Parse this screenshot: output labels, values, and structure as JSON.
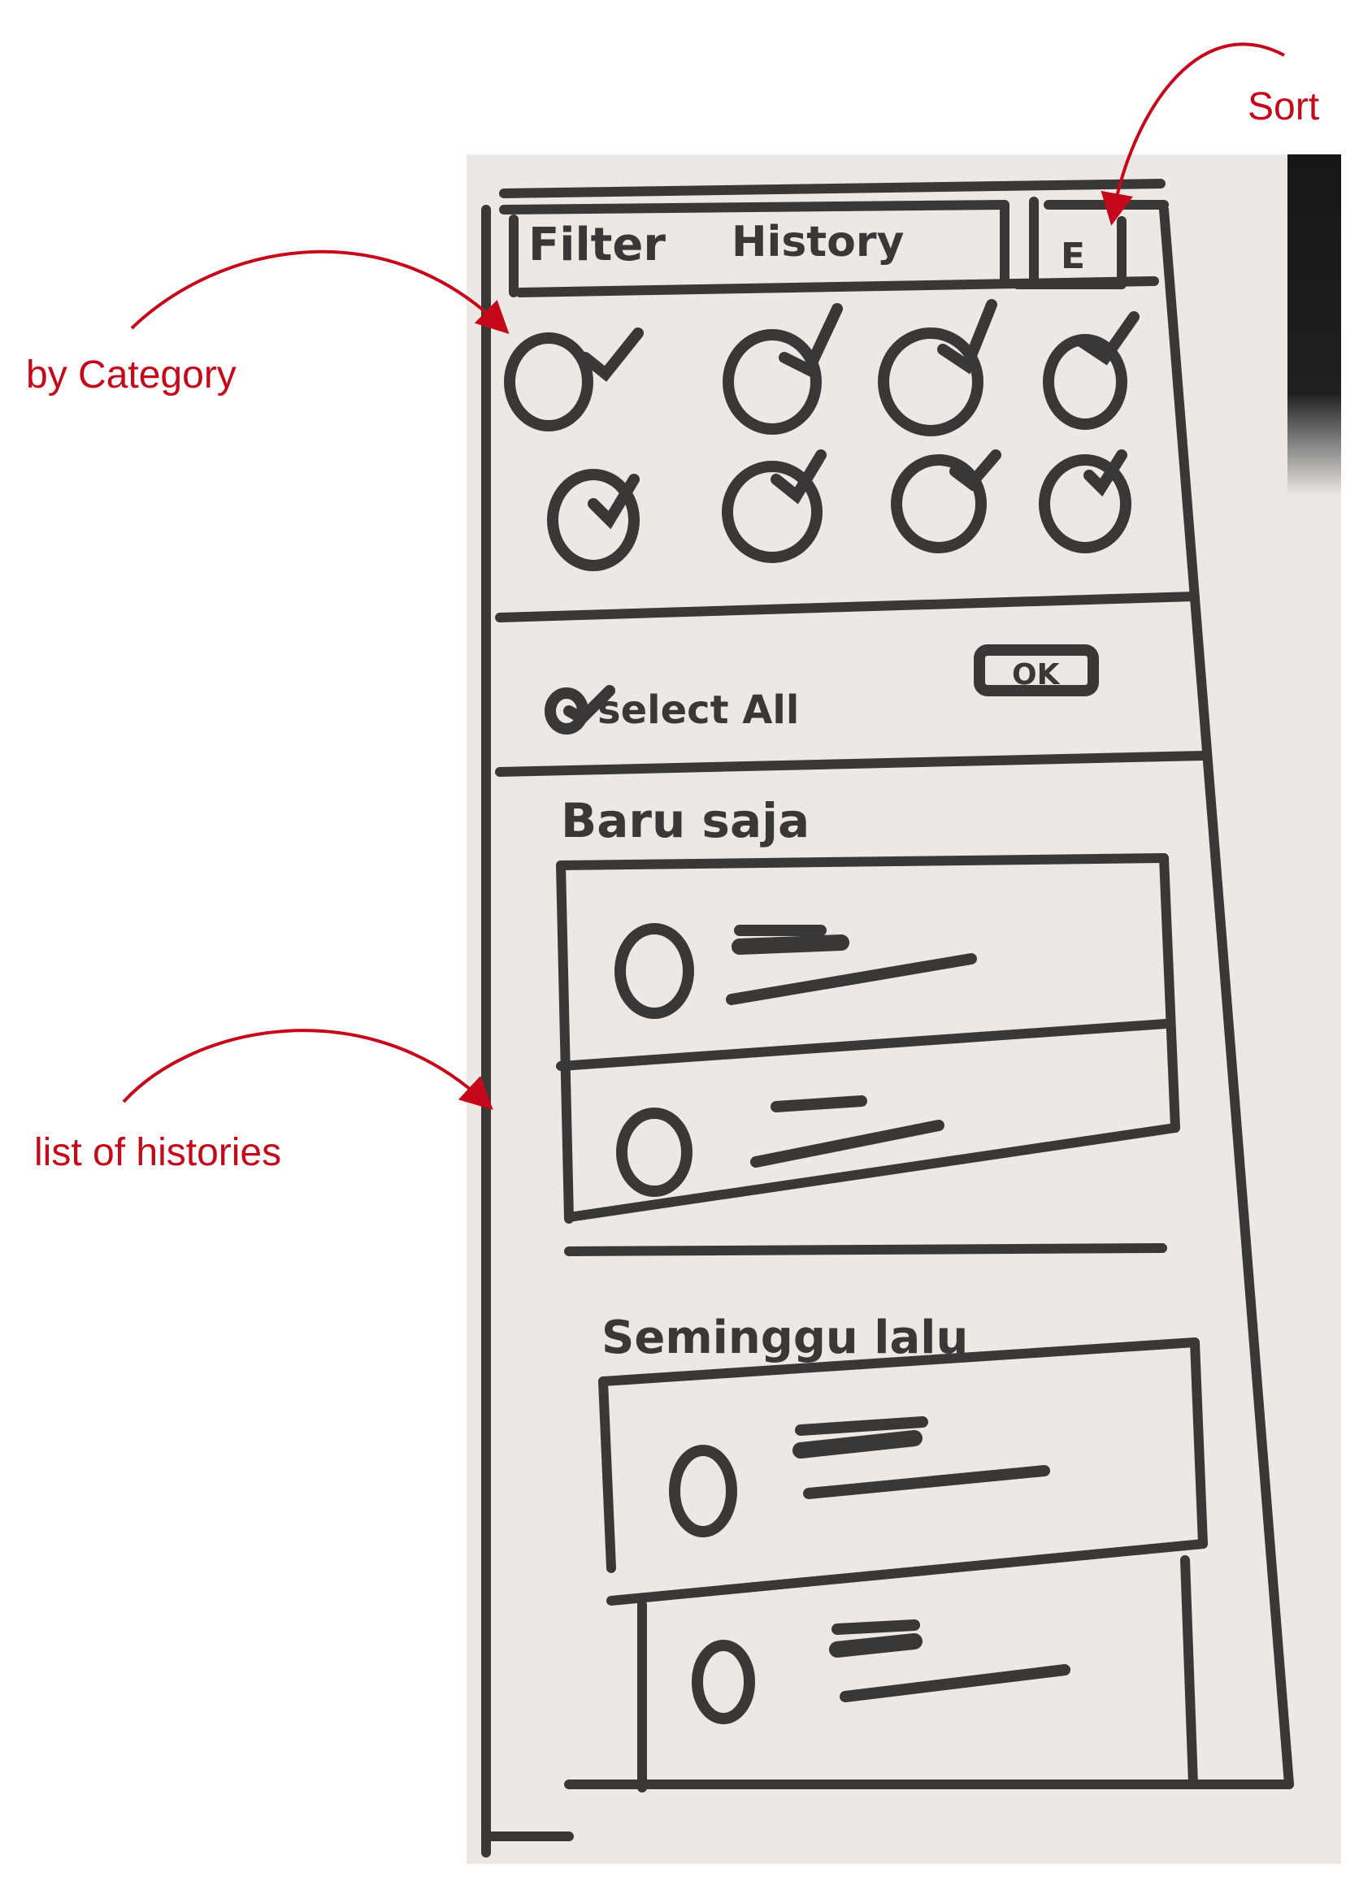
{
  "annotations": {
    "sort_label": "Sort",
    "category_label": "by Category",
    "histories_label": "list of histories"
  },
  "sketch": {
    "header_filter_text": "Filter",
    "header_history_text": "History",
    "sort_button_text": "E",
    "select_all_text": "select All",
    "ok_button_text": "OK",
    "recent_heading": "Baru saja",
    "earlier_heading": "Seminggu lalu"
  },
  "colors": {
    "annotation": "#c5081a",
    "ink": "#3a3836",
    "paper": "#ece9e4"
  },
  "icons": {
    "sort": "sort-icon",
    "category_check": "checkmark-icon"
  }
}
